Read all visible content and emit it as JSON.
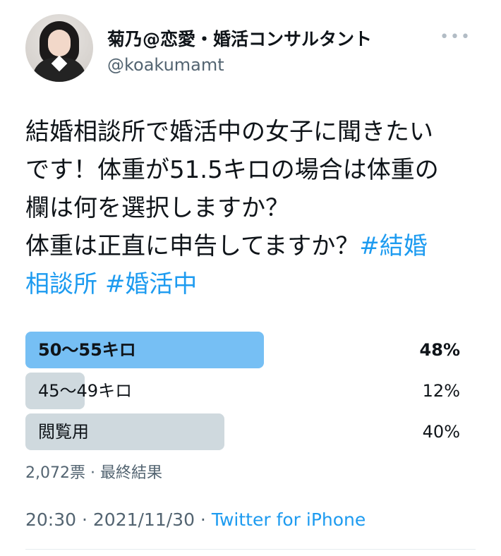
{
  "user": {
    "name": "菊乃@恋愛・婚活コンサルタント",
    "handle": "@koakumamt"
  },
  "more_icon": "more-dots-icon",
  "tweet": {
    "text_lines": [
      "結婚相談所で婚活中の女子に聞きたい",
      "です！体重が51.5キロの場合は体重の",
      "欄は何を選択しますか？",
      "体重は正直に申告してますか？"
    ],
    "hashtag_1_start": "#結婚",
    "hashtag_1_end": "相談所",
    "hashtag_2": "#婚活中"
  },
  "poll": {
    "options": [
      {
        "label": "50〜55キロ",
        "percent_text": "48%",
        "percent": 48,
        "winner": true
      },
      {
        "label": "45〜49キロ",
        "percent_text": "12%",
        "percent": 12,
        "winner": false
      },
      {
        "label": "閲覧用",
        "percent_text": "40%",
        "percent": 40,
        "winner": false
      }
    ],
    "votes_status": "2,072票 · 最終結果"
  },
  "meta": {
    "time": "20:30",
    "separator": " · ",
    "date": "2021/11/30",
    "source": "Twitter for iPhone"
  },
  "colors": {
    "link": "#1d9bf0",
    "winner_bar": "#76bff4",
    "other_bar": "#cfd9de",
    "secondary_text": "#536471"
  }
}
